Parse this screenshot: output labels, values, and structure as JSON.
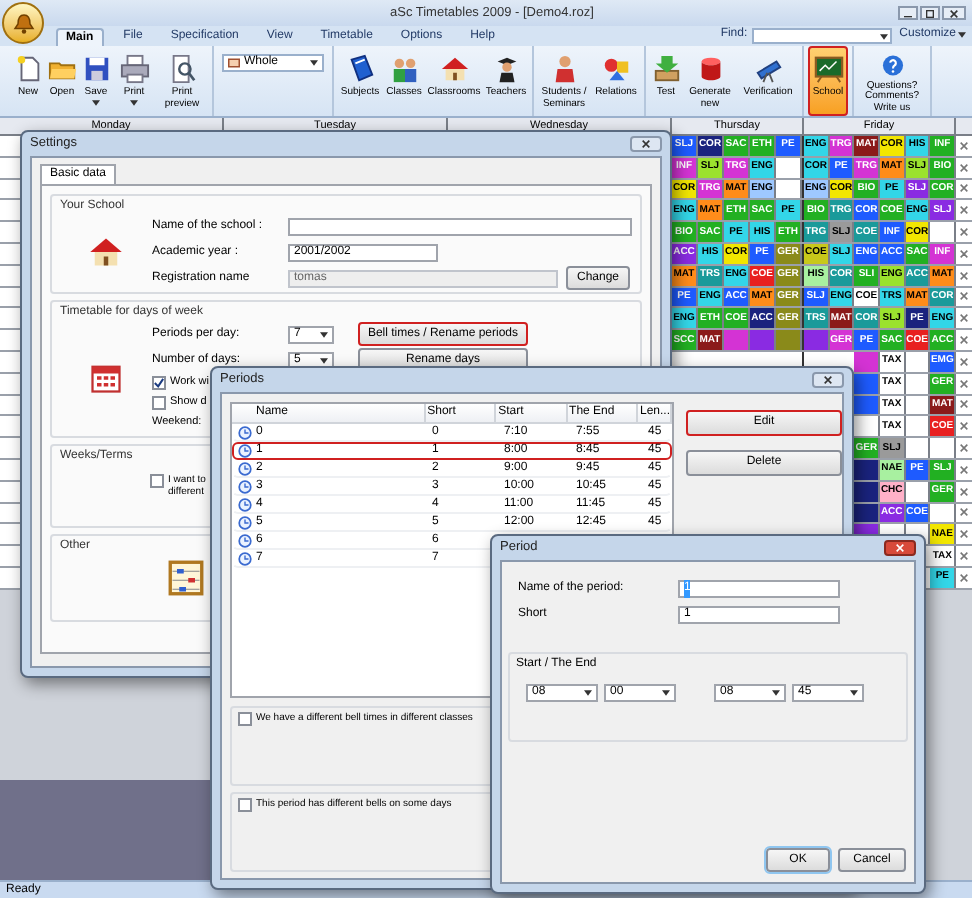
{
  "app": {
    "title": "aSc Timetables 2009 - [Demo4.roz]"
  },
  "tabs": [
    {
      "label": "Main",
      "selected": true
    },
    {
      "label": "File",
      "selected": false
    },
    {
      "label": "Specification",
      "selected": false
    },
    {
      "label": "View",
      "selected": false
    },
    {
      "label": "Timetable",
      "selected": false
    },
    {
      "label": "Options",
      "selected": false
    },
    {
      "label": "Help",
      "selected": false
    }
  ],
  "find": {
    "label": "Find:"
  },
  "customize": {
    "label": "Customize"
  },
  "ribbon": [
    {
      "kind": "buttons",
      "buttons": [
        {
          "label": "New",
          "selected": false,
          "menu": false
        },
        {
          "label": "Open",
          "selected": false,
          "menu": false
        },
        {
          "label": "Save",
          "selected": false,
          "menu": true
        },
        {
          "label": "Print",
          "selected": false,
          "menu": true
        },
        {
          "label": "Print preview",
          "selected": false,
          "menu": false
        }
      ]
    },
    {
      "kind": "dropdown",
      "value": "Whole"
    },
    {
      "kind": "buttons",
      "buttons": [
        {
          "label": "Subjects",
          "selected": false,
          "menu": false
        },
        {
          "label": "Classes",
          "selected": false,
          "menu": false
        },
        {
          "label": "Classrooms",
          "selected": false,
          "menu": false
        },
        {
          "label": "Teachers",
          "selected": false,
          "menu": false
        }
      ]
    },
    {
      "kind": "buttons",
      "buttons": [
        {
          "label": "Students / Seminars",
          "selected": false,
          "menu": false
        },
        {
          "label": "Relations",
          "selected": false,
          "menu": false
        }
      ]
    },
    {
      "kind": "buttons",
      "buttons": [
        {
          "label": "Test",
          "selected": false,
          "menu": false
        },
        {
          "label": "Generate new",
          "selected": false,
          "menu": false
        },
        {
          "label": "Verification",
          "selected": false,
          "menu": false
        }
      ]
    },
    {
      "kind": "buttons",
      "buttons": [
        {
          "label": "School",
          "selected": true,
          "menu": false
        }
      ]
    },
    {
      "kind": "buttons",
      "buttons": [
        {
          "label": "Questions? Comments? Write us",
          "selected": false,
          "menu": false
        }
      ]
    }
  ],
  "timetable": {
    "days": [
      "Monday",
      "Tuesday",
      "Wednesday",
      "Thursday",
      "Friday"
    ],
    "rows": [
      {
        "thursday": [
          {
            "text": "SLJ",
            "color": "#1e5bff"
          },
          {
            "text": "COR",
            "color": "#1a237e"
          },
          {
            "text": "SAC",
            "color": "#22b022"
          },
          {
            "text": "ETH",
            "color": "#22b022"
          },
          {
            "text": "PE",
            "color": "#1e5bff"
          }
        ],
        "friday": [
          {
            "text": "ENG",
            "color": "#33d6e8"
          },
          {
            "text": "TRG",
            "color": "#d433d4"
          },
          {
            "text": "MAT",
            "color": "#8b1a1a"
          },
          {
            "text": "COR",
            "color": "#f2e600"
          },
          {
            "text": "HIS",
            "color": "#33d6e8"
          },
          {
            "text": "INF",
            "color": "#22b022"
          }
        ]
      },
      {
        "thursday": [
          {
            "text": "INF",
            "color": "#d433d4"
          },
          {
            "text": "SLJ",
            "color": "#9be22e"
          },
          {
            "text": "TRG",
            "color": "#d433d4"
          },
          {
            "text": "ENG",
            "color": "#33d6e8"
          },
          {
            "color": "#ffffff"
          }
        ],
        "friday": [
          {
            "text": "COR",
            "color": "#33d6e8"
          },
          {
            "text": "PE",
            "color": "#1e5bff"
          },
          {
            "text": "TRG",
            "color": "#d433d4"
          },
          {
            "text": "MAT",
            "color": "#ff8c1a"
          },
          {
            "text": "SLJ",
            "color": "#9be22e"
          },
          {
            "text": "BIO",
            "color": "#22b022"
          }
        ]
      },
      {
        "thursday": [
          {
            "text": "COR",
            "color": "#f2e600"
          },
          {
            "text": "TRG",
            "color": "#d433d4"
          },
          {
            "text": "MAT",
            "color": "#ff8c1a"
          },
          {
            "text": "ENG",
            "color": "#9ec8ff"
          },
          {
            "color": "#ffffff"
          }
        ],
        "friday": [
          {
            "text": "ENG",
            "color": "#9ec8ff"
          },
          {
            "text": "COR",
            "color": "#f2e600"
          },
          {
            "text": "BIO",
            "color": "#22b022"
          },
          {
            "text": "PE",
            "color": "#33d6e8"
          },
          {
            "text": "SLJ",
            "color": "#8a2be2"
          },
          {
            "text": "COR",
            "color": "#22b022"
          }
        ]
      },
      {
        "thursday": [
          {
            "text": "ENG",
            "color": "#33d6e8"
          },
          {
            "text": "MAT",
            "color": "#ff8c1a"
          },
          {
            "text": "ETH",
            "color": "#22b022"
          },
          {
            "text": "SAC",
            "color": "#22b022"
          },
          {
            "text": "PE",
            "color": "#33d6e8"
          }
        ],
        "friday": [
          {
            "text": "BIO",
            "color": "#22b022"
          },
          {
            "text": "TRG",
            "color": "#1a9a9a"
          },
          {
            "text": "COR",
            "color": "#1e5bff"
          },
          {
            "text": "COE",
            "color": "#22b022"
          },
          {
            "text": "ENG",
            "color": "#33d6e8"
          },
          {
            "text": "SLJ",
            "color": "#8a2be2"
          }
        ]
      },
      {
        "thursday": [
          {
            "text": "BIO",
            "color": "#22b022"
          },
          {
            "text": "SAC",
            "color": "#22b022"
          },
          {
            "text": "PE",
            "color": "#33d6e8"
          },
          {
            "text": "HIS",
            "color": "#33d6e8"
          },
          {
            "text": "ETH",
            "color": "#22b022"
          }
        ],
        "friday": [
          {
            "text": "TRG",
            "color": "#1a9a9a"
          },
          {
            "text": "SLJ",
            "color": "#9a9a9a"
          },
          {
            "text": "COE",
            "color": "#1a9a9a"
          },
          {
            "text": "INF",
            "color": "#1e5bff"
          },
          {
            "text": "COR",
            "color": "#f2e600"
          },
          {
            "color": "#ffffff"
          }
        ]
      },
      {
        "thursday": [
          {
            "text": "ACC",
            "color": "#8a2be2"
          },
          {
            "text": "HIS",
            "color": "#33d6e8"
          },
          {
            "text": "COR",
            "color": "#f2e600"
          },
          {
            "text": "PE",
            "color": "#1e5bff"
          },
          {
            "text": "GER",
            "color": "#8a8a1a"
          }
        ],
        "friday": [
          {
            "text": "COE",
            "color": "#c8c81a"
          },
          {
            "text": "SLJ",
            "color": "#33d6e8"
          },
          {
            "text": "ENG",
            "color": "#1e5bff"
          },
          {
            "text": "ACC",
            "color": "#1e5bff"
          },
          {
            "text": "SAC",
            "color": "#22b022"
          },
          {
            "text": "INF",
            "color": "#d433d4"
          }
        ]
      },
      {
        "thursday": [
          {
            "text": "MAT",
            "color": "#ff8c1a"
          },
          {
            "text": "TRS",
            "color": "#1a9a9a"
          },
          {
            "text": "ENG",
            "color": "#33d6e8"
          },
          {
            "text": "COE",
            "color": "#e82020"
          },
          {
            "text": "GER",
            "color": "#8a8a1a"
          }
        ],
        "friday": [
          {
            "text": "HIS",
            "color": "#a8f0a0"
          },
          {
            "text": "COR",
            "color": "#1a9a9a"
          },
          {
            "text": "SLI",
            "color": "#22b022"
          },
          {
            "text": "ENG",
            "color": "#9be22e"
          },
          {
            "text": "ACC",
            "color": "#1a9a9a"
          },
          {
            "text": "MAT",
            "color": "#ff8c1a"
          }
        ]
      },
      {
        "thursday": [
          {
            "text": "PE",
            "color": "#1e5bff"
          },
          {
            "text": "ENG",
            "color": "#33d6e8"
          },
          {
            "text": "ACC",
            "color": "#1e5bff"
          },
          {
            "text": "MAT",
            "color": "#ff8c1a"
          },
          {
            "text": "GER",
            "color": "#8a8a1a"
          }
        ],
        "friday": [
          {
            "text": "SLJ",
            "color": "#1e5bff"
          },
          {
            "text": "ENG",
            "color": "#33d6e8"
          },
          {
            "text": "COE",
            "color": "#ffffff"
          },
          {
            "text": "TRS",
            "color": "#33d6e8"
          },
          {
            "text": "MAT",
            "color": "#ff8c1a"
          },
          {
            "text": "COR",
            "color": "#1a9a9a"
          }
        ]
      },
      {
        "thursday": [
          {
            "text": "ENG",
            "color": "#33d6e8"
          },
          {
            "text": "ETH",
            "color": "#22b022"
          },
          {
            "text": "COE",
            "color": "#22b022"
          },
          {
            "text": "ACC",
            "color": "#1a237e"
          },
          {
            "text": "GER",
            "color": "#8a8a1a"
          }
        ],
        "friday": [
          {
            "text": "TRS",
            "color": "#1a9a9a"
          },
          {
            "text": "MAT",
            "color": "#8b1a1a"
          },
          {
            "text": "COR",
            "color": "#1a9a9a"
          },
          {
            "text": "SLJ",
            "color": "#9be22e"
          },
          {
            "text": "PE",
            "color": "#1a237e"
          },
          {
            "text": "ENG",
            "color": "#33d6e8"
          }
        ]
      },
      {
        "thursday": [
          {
            "text": "SCC",
            "color": "#22b022"
          },
          {
            "text": "MAT",
            "color": "#8b1a1a"
          },
          {
            "color": "#d433d4"
          },
          {
            "color": "#8a2be2"
          },
          {
            "color": "#8a8a1a"
          }
        ],
        "friday": [
          {
            "color": "#8a2be2"
          },
          {
            "text": "GER",
            "color": "#d433d4"
          },
          {
            "text": "PE",
            "color": "#1e5bff"
          },
          {
            "text": "SAC",
            "color": "#22b022"
          },
          {
            "text": "COE",
            "color": "#e82020"
          },
          {
            "text": "ACC",
            "color": "#22b022"
          }
        ]
      },
      {
        "friday": [
          {
            "color": "#d433d4"
          },
          {
            "text": "TAX",
            "color": "#ffffff"
          },
          {
            "color": "#ffffff"
          },
          {
            "text": "EMG",
            "color": "#1e5bff"
          }
        ]
      },
      {
        "friday": [
          {
            "color": "#1e5bff"
          },
          {
            "text": "TAX",
            "color": "#ffffff"
          },
          {
            "color": "#ffffff"
          },
          {
            "text": "GER",
            "color": "#22b022"
          }
        ]
      },
      {
        "friday": [
          {
            "color": "#1e5bff"
          },
          {
            "text": "TAX",
            "color": "#ffffff"
          },
          {
            "color": "#ffffff"
          },
          {
            "text": "MAT",
            "color": "#8b1a1a"
          }
        ]
      },
      {
        "friday": [
          {
            "color": "#ffffff"
          },
          {
            "text": "TAX",
            "color": "#ffffff"
          },
          {
            "color": "#ffffff"
          },
          {
            "text": "COE",
            "color": "#e82020"
          }
        ]
      },
      {
        "friday": [
          {
            "text": "GER",
            "color": "#22b022"
          },
          {
            "text": "SLJ",
            "color": "#9a9a9a"
          },
          {
            "color": "#ffffff"
          },
          {
            "color": "#ffffff"
          }
        ]
      },
      {
        "friday": [
          {
            "color": "#1a237e"
          },
          {
            "text": "NAE",
            "color": "#a8f0a0"
          },
          {
            "text": "PE",
            "color": "#1e5bff"
          },
          {
            "text": "SLJ",
            "color": "#22b022"
          }
        ]
      },
      {
        "friday": [
          {
            "color": "#1a237e"
          },
          {
            "text": "CHC",
            "color": "#ffb0c8"
          },
          {
            "color": "#ffffff"
          },
          {
            "text": "GER",
            "color": "#22b022"
          }
        ]
      },
      {
        "friday": [
          {
            "color": "#1a237e"
          },
          {
            "text": "ACC",
            "color": "#8a2be2"
          },
          {
            "text": "COE",
            "color": "#1e5bff"
          },
          {
            "color": "#ffffff"
          }
        ]
      },
      {
        "friday": [
          {
            "color": "#8a2be2"
          },
          {
            "color": "#ffffff"
          },
          {
            "color": "#ffffff"
          },
          {
            "text": "NAE",
            "color": "#f2e600"
          }
        ]
      },
      {
        "friday": [
          {
            "text": "TAX",
            "color": "#ffffff"
          }
        ]
      },
      {
        "friday": [
          {
            "text": "PE",
            "color": "#33d6e8"
          }
        ]
      }
    ]
  },
  "settings": {
    "title": "Settings",
    "tabs": [
      {
        "label": "Basic data",
        "selected": true
      }
    ],
    "school": {
      "legend": "Your School",
      "fields": [
        {
          "label": "Name of the school :",
          "kind": "text"
        },
        {
          "label": "Academic year :",
          "value": "2001/2002",
          "kind": "short"
        },
        {
          "label": "Registration name",
          "value": "tomas",
          "kind": "disabled",
          "button": "Change"
        }
      ]
    },
    "days_of_week": {
      "legend": "Timetable for days of week",
      "periods_label": "Periods per day:",
      "periods_value": "7",
      "bell_button": {
        "label": "Bell times / Rename periods",
        "highlighted": true
      },
      "days_label": "Number of days:",
      "days_value": "5",
      "rename_button": {
        "label": "Rename days",
        "highlighted": false
      },
      "checks": [
        {
          "label": "Work wi",
          "checked": true
        },
        {
          "label": "Show d",
          "checked": false
        }
      ],
      "weekend_label": "Weekend:"
    },
    "weeks": {
      "legend": "Weeks/Terms",
      "check": {
        "lines": [
          "I want to",
          "different"
        ],
        "checked": false
      }
    },
    "other": {
      "legend": "Other"
    }
  },
  "periods": {
    "title": "Periods",
    "columns": [
      "Name",
      "Short",
      "Start",
      "The End",
      "Len..."
    ],
    "rows": [
      {
        "cells": [
          "0",
          "0",
          "7:10",
          "7:55",
          "45"
        ],
        "highlighted": false
      },
      {
        "cells": [
          "1",
          "1",
          "8:00",
          "8:45",
          "45"
        ],
        "highlighted": true
      },
      {
        "cells": [
          "2",
          "2",
          "9:00",
          "9:45",
          "45"
        ],
        "highlighted": false
      },
      {
        "cells": [
          "3",
          "3",
          "10:00",
          "10:45",
          "45"
        ],
        "highlighted": false
      },
      {
        "cells": [
          "4",
          "4",
          "11:00",
          "11:45",
          "45"
        ],
        "highlighted": false
      },
      {
        "cells": [
          "5",
          "5",
          "12:00",
          "12:45",
          "45"
        ],
        "highlighted": false
      },
      {
        "cells": [
          "6",
          "6"
        ],
        "highlighted": false
      },
      {
        "cells": [
          "7",
          "7"
        ],
        "highlighted": false
      }
    ],
    "buttons": [
      {
        "label": "Edit",
        "highlighted": true
      },
      {
        "label": "Delete",
        "highlighted": false
      }
    ],
    "options": [
      {
        "label": "We have a different bell times in different classes",
        "checked": false
      },
      {
        "label": "This period has different bells on some days",
        "checked": false
      }
    ]
  },
  "period": {
    "title": "Period",
    "name_label": "Name of the period:",
    "name_value": "1",
    "short_label": "Short",
    "short_value": "1",
    "times_legend": "Start / The End",
    "times": [
      "08",
      "00",
      "08",
      "45"
    ],
    "ok": "OK",
    "cancel": "Cancel"
  },
  "status_bar": {
    "text": "Ready"
  }
}
